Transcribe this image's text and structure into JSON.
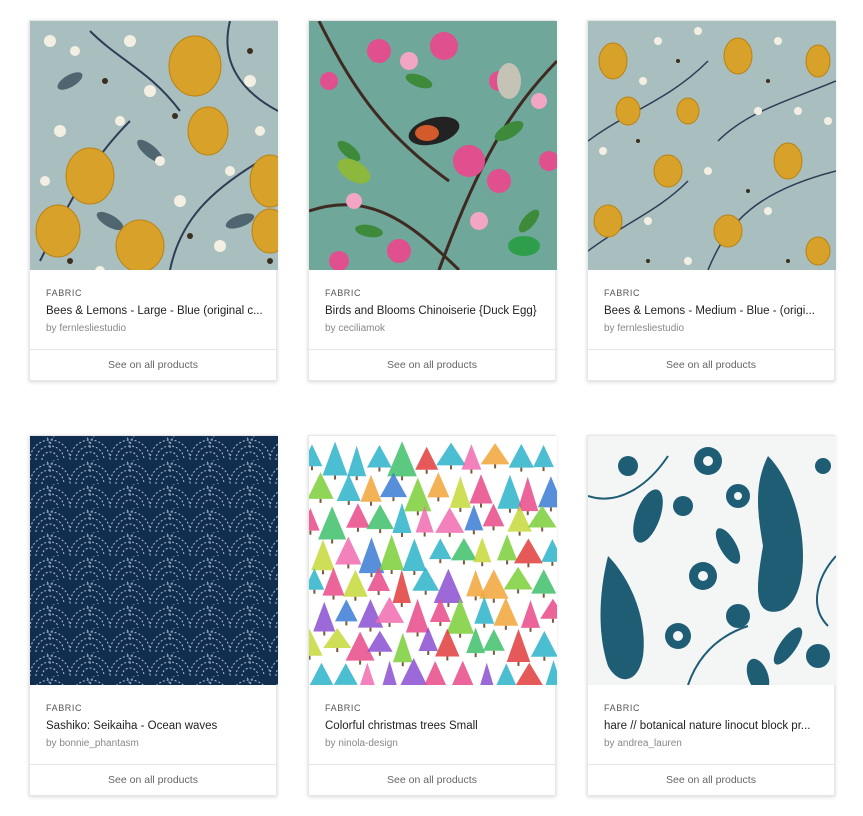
{
  "products": [
    {
      "category": "FABRIC",
      "title": "Bees & Lemons - Large - Blue (original c...",
      "by": "by",
      "designer": "fernlesliestudio",
      "cta": "See on all products",
      "pattern": "bees-lemons-large"
    },
    {
      "category": "FABRIC",
      "title": "Birds and Blooms Chinoiserie {Duck Egg}",
      "by": "by",
      "designer": "ceciliamok",
      "cta": "See on all products",
      "pattern": "birds-blooms"
    },
    {
      "category": "FABRIC",
      "title": "Bees & Lemons - Medium - Blue - (origi...",
      "by": "by",
      "designer": "fernlesliestudio",
      "cta": "See on all products",
      "pattern": "bees-lemons-medium"
    },
    {
      "category": "FABRIC",
      "title": "Sashiko: Seikaiha - Ocean waves",
      "by": "by",
      "designer": "bonnie_phantasm",
      "cta": "See on all products",
      "pattern": "sashiko-waves"
    },
    {
      "category": "FABRIC",
      "title": "Colorful christmas trees Small",
      "by": "by",
      "designer": "ninola-design",
      "cta": "See on all products",
      "pattern": "christmas-trees"
    },
    {
      "category": "FABRIC",
      "title": "hare // botanical nature linocut block pr...",
      "by": "by",
      "designer": "andrea_lauren",
      "cta": "See on all products",
      "pattern": "hare-linocut"
    }
  ],
  "colors": {
    "lemon_bg": "#a9bfbf",
    "lemon": "#d7a12a",
    "birds_bg": "#6fa79a",
    "sashiko_bg": "#102848",
    "hare_blue": "#1f5d75"
  }
}
